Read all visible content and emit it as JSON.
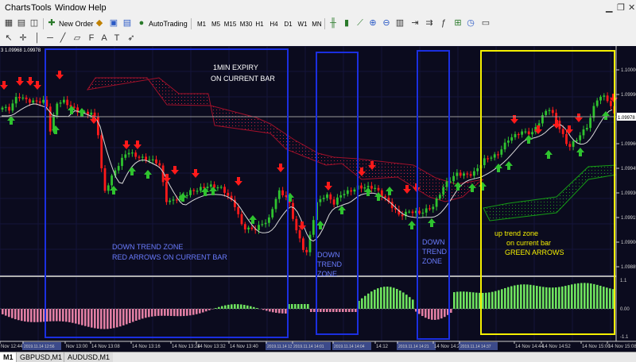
{
  "menu": {
    "charts": "Charts",
    "tools": "Tools",
    "window": "Window",
    "help": "Help"
  },
  "toolbar": {
    "new_order": "New Order",
    "autotrading": "AutoTrading",
    "timeframes": [
      "M1",
      "M5",
      "M15",
      "M30",
      "H1",
      "H4",
      "D1",
      "W1",
      "MN"
    ]
  },
  "chart": {
    "price_info": "3 1.09968 1.09978",
    "current_price_label": "1.09978",
    "price_ticks": [
      "1.10000",
      "1.09990",
      "1.09975",
      "1.09960",
      "1.09945",
      "1.09930",
      "1.09915",
      "1.09900",
      "1.09885"
    ],
    "indicator_ticks": [
      "1.1",
      "0.00",
      "-1.1"
    ],
    "time_labels": [
      "Nov 12:44",
      "2019.11.14 12:56",
      "Nov 13:00",
      "14 Nov 13:08",
      "14 Nov 13:16",
      "14 Nov 13:24",
      "14 Nov 13:32",
      "14 Nov 13:40",
      "2019.11.14 13:47",
      "2019.11.14 14:01",
      "2019.11.14 14:04",
      "14:12",
      "2019.11.14 14:21",
      "14 Nov 14:28",
      "2019.11.14 14:37",
      "14 Nov 14:44",
      "14 Nov 14:52",
      "14 Nov 15:00",
      "14 Nov 15:08"
    ],
    "annotations": {
      "expiry_line1": "1MIN EXPIRY",
      "expiry_line2": "ON CURRENT BAR",
      "down_zone_1": "DOWN TREND ZONE",
      "down_zone_2": "RED ARROWS ON CURRENT BAR",
      "down_a_1": "DOWN",
      "down_a_2": "TREND",
      "down_a_3": "ZONE",
      "down_b_1": "DOWN",
      "down_b_2": "TREND",
      "down_b_3": "ZONE",
      "up_zone_1": "up trend zone",
      "up_zone_2": "on current bar",
      "up_zone_3": "GREEN ARROWS"
    }
  },
  "tabs": [
    "M1",
    "GBPUSD,M1",
    "AUDUSD,M1"
  ],
  "colors": {
    "bull": "#2fc32f",
    "bear": "#ff1a1a",
    "down_box": "#1b2fe0",
    "up_box": "#f5f000",
    "hist_pos": "#6fe35f",
    "hist_neg": "#e27fa4",
    "cloud_red": "#a0102a",
    "cloud_green": "#169a16"
  }
}
